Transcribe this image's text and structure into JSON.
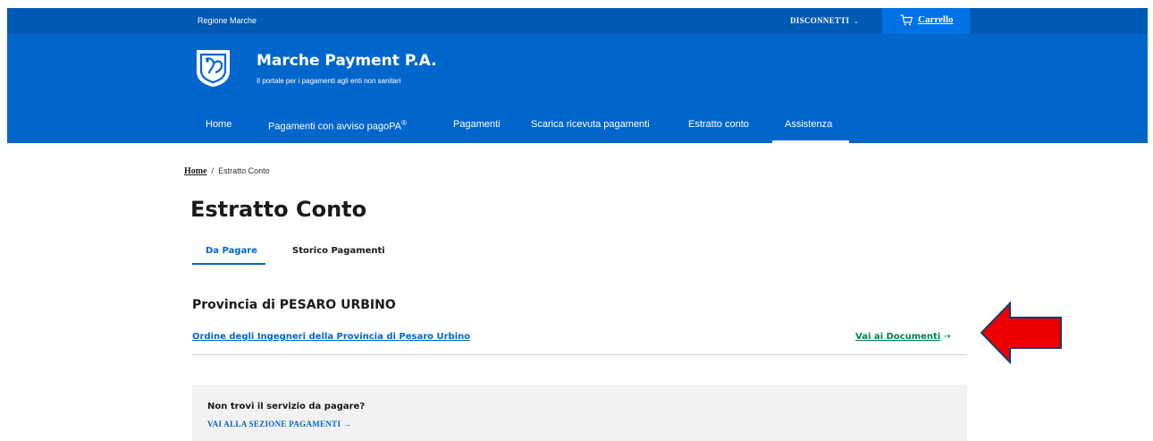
{
  "header": {
    "region": "Regione Marche",
    "disconnect_label": "DISCONNETTI",
    "cart_label": "Carrello",
    "brand_title": "Marche Payment P.A.",
    "brand_subtitle": "Il portale per i pagamenti agli enti non sanitari",
    "colors": {
      "primary": "#0066cc",
      "slim": "#0059b3"
    }
  },
  "nav": {
    "items": [
      {
        "label": "Home"
      },
      {
        "label": "Pagamenti con avviso pagoPA",
        "sup": "®"
      },
      {
        "label": "Pagamenti"
      },
      {
        "label": "Scarica ricevuta pagamenti"
      },
      {
        "label": "Estratto conto"
      },
      {
        "label": "Assistenza",
        "active": true
      }
    ]
  },
  "breadcrumb": {
    "home": "Home",
    "separator": "/",
    "current": "Estratto Conto"
  },
  "page": {
    "title": "Estratto Conto",
    "tabs": [
      {
        "label": "Da Pagare",
        "active": true
      },
      {
        "label": "Storico Pagamenti"
      }
    ],
    "section_title": "Provincia di PESARO URBINO",
    "org_link": "Ordine degli Ingegneri della Provincia di Pesaro Urbino",
    "docs_link": "Vai ai Documenti",
    "notice": {
      "question": "Non trovi il servizio da pagare?",
      "link": "VAI ALLA SEZIONE PAGAMENTI"
    }
  },
  "icons": {
    "cart": "cart-icon",
    "logo": "regione-marche-logo",
    "arrow": "arrow-right-icon",
    "callout": "red-arrow-annotation"
  },
  "callout_color": "#ee0000"
}
